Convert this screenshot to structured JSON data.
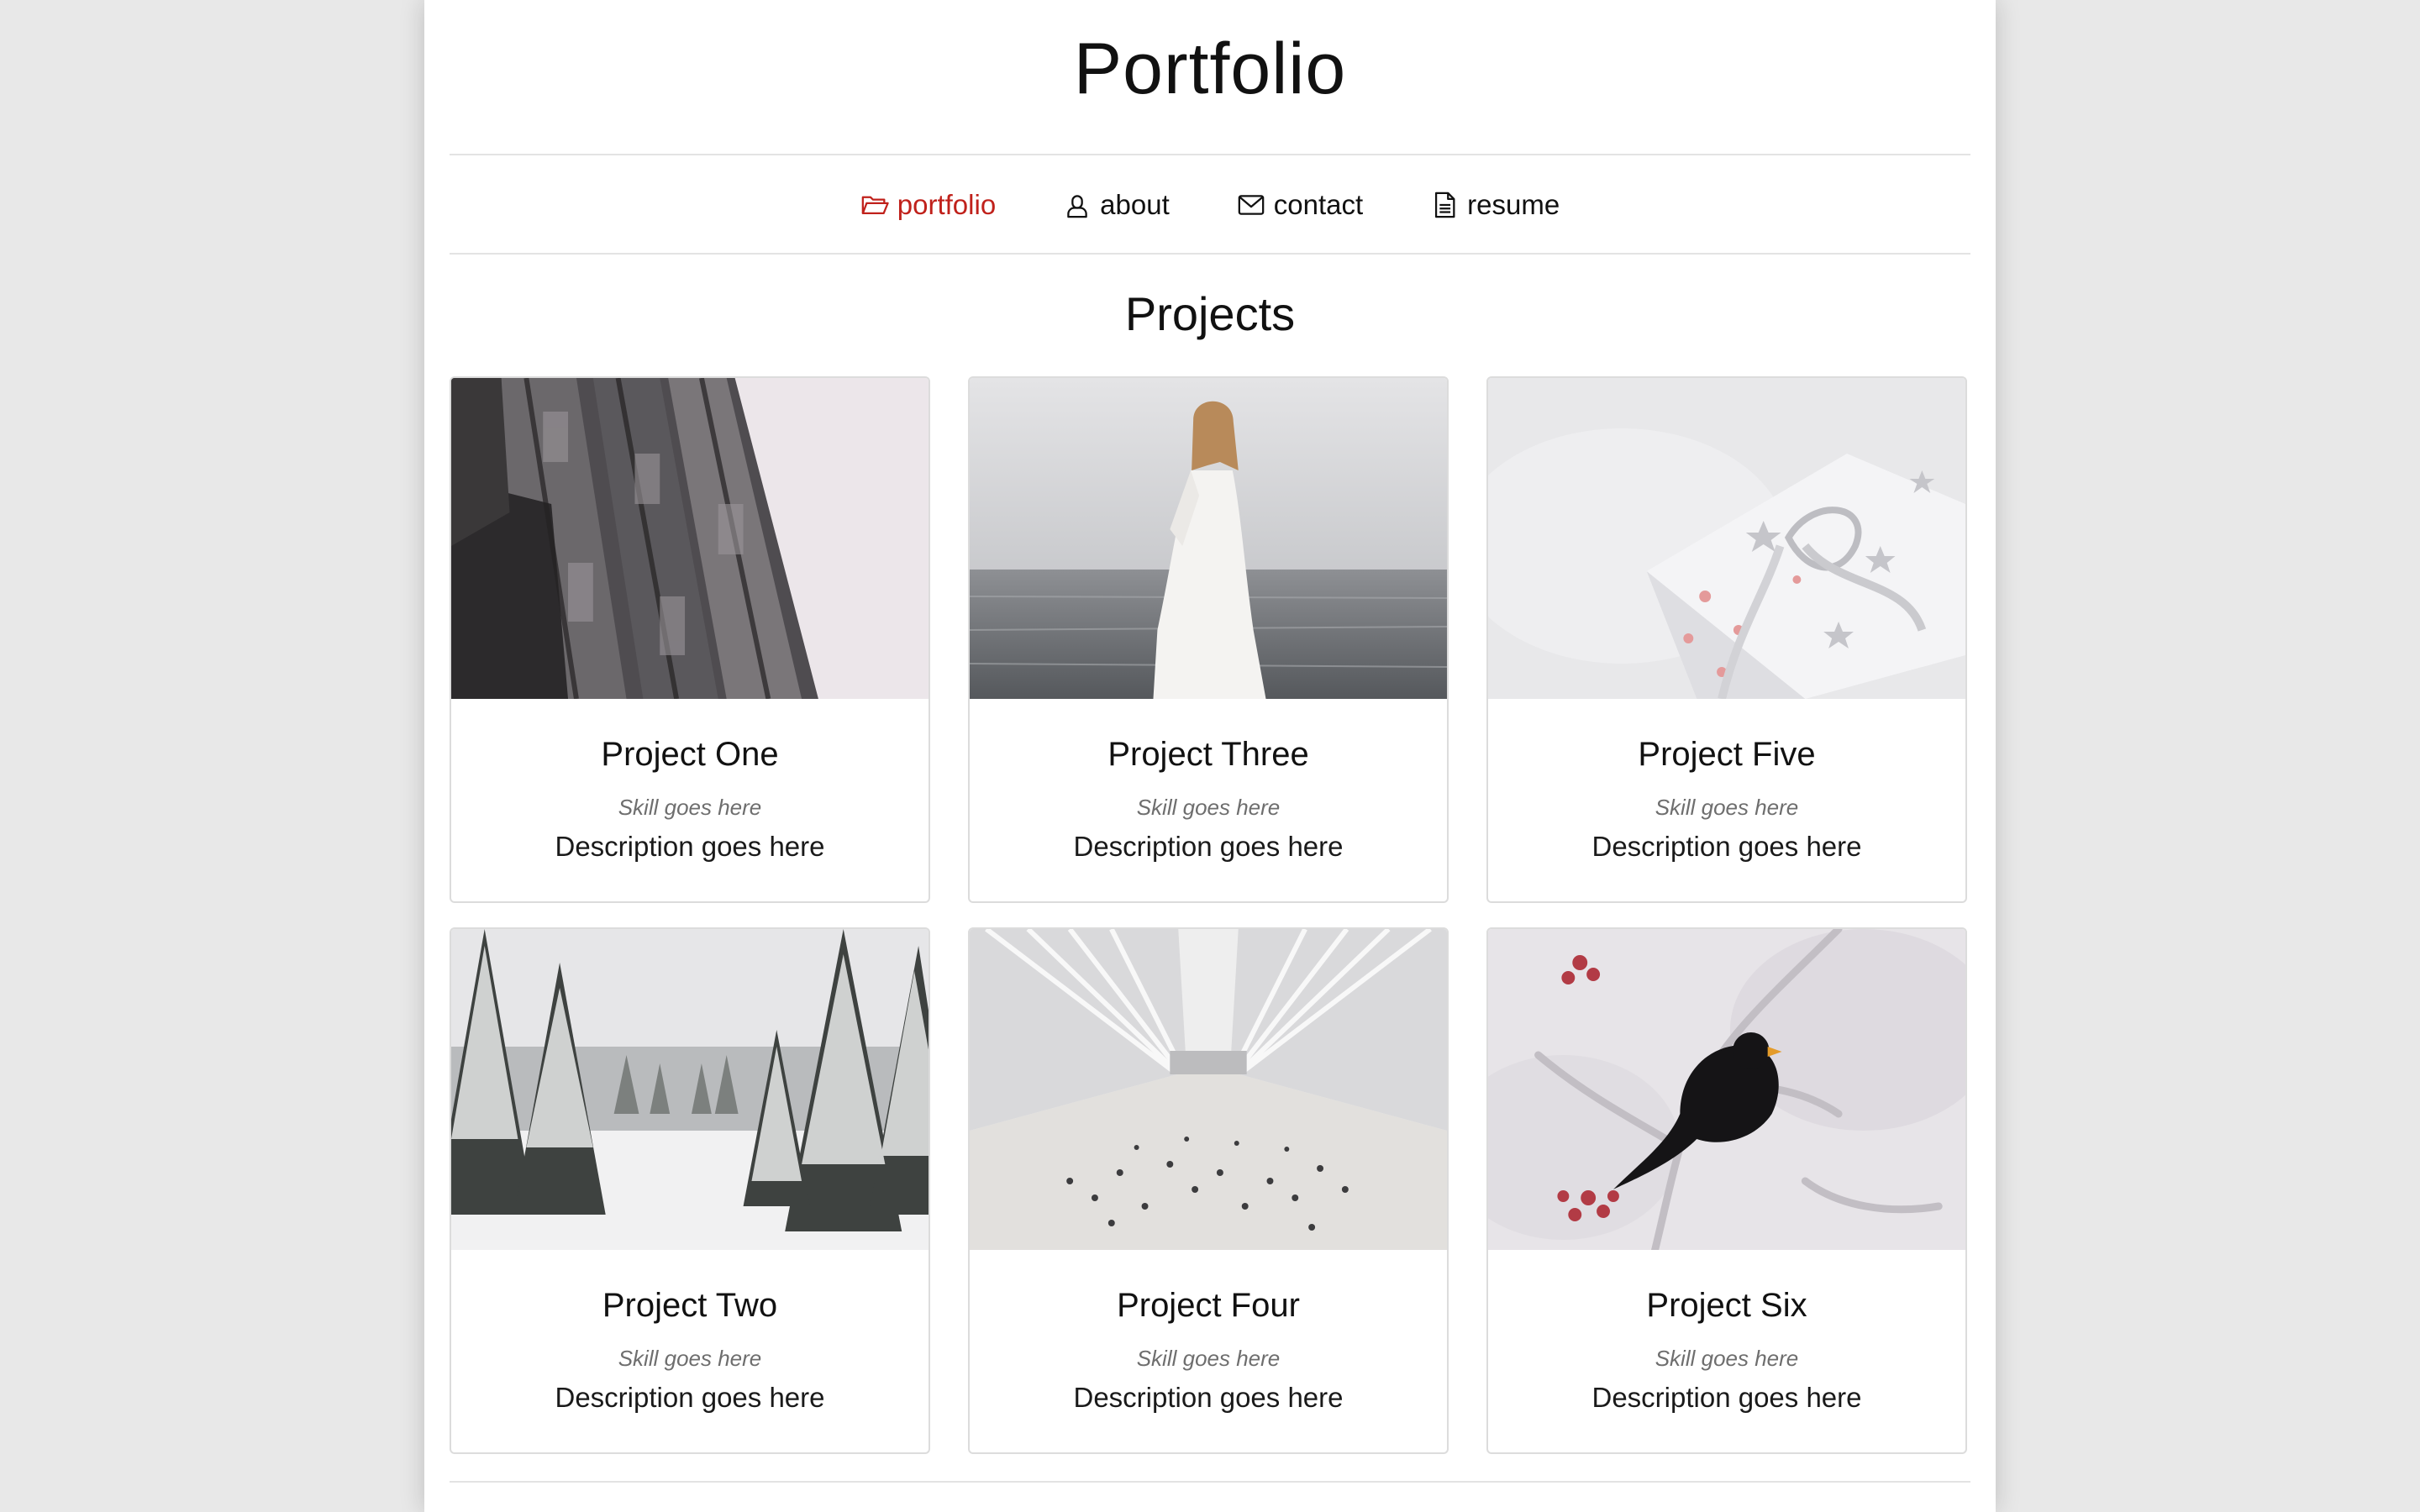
{
  "header": {
    "title": "Portfolio"
  },
  "nav": {
    "items": [
      {
        "label": "portfolio",
        "icon": "folder-open-icon",
        "active": true
      },
      {
        "label": "about",
        "icon": "user-icon",
        "active": false
      },
      {
        "label": "contact",
        "icon": "envelope-icon",
        "active": false
      },
      {
        "label": "resume",
        "icon": "document-icon",
        "active": false
      }
    ],
    "active_color": "#c0211b"
  },
  "projects": {
    "heading": "Projects",
    "cards": [
      {
        "title": "Project One",
        "skill": "Skill goes here",
        "description": "Description goes here",
        "image": "ornate-building-facade"
      },
      {
        "title": "Project Three",
        "skill": "Skill goes here",
        "description": "Description goes here",
        "image": "woman-white-dress-sea"
      },
      {
        "title": "Project Five",
        "skill": "Skill goes here",
        "description": "Description goes here",
        "image": "gift-box-with-ribbon"
      },
      {
        "title": "Project Two",
        "skill": "Skill goes here",
        "description": "Description goes here",
        "image": "snowy-pine-forest"
      },
      {
        "title": "Project Four",
        "skill": "Skill goes here",
        "description": "Description goes here",
        "image": "white-station-hall"
      },
      {
        "title": "Project Six",
        "skill": "Skill goes here",
        "description": "Description goes here",
        "image": "blackbird-on-frosty-branch"
      }
    ]
  }
}
